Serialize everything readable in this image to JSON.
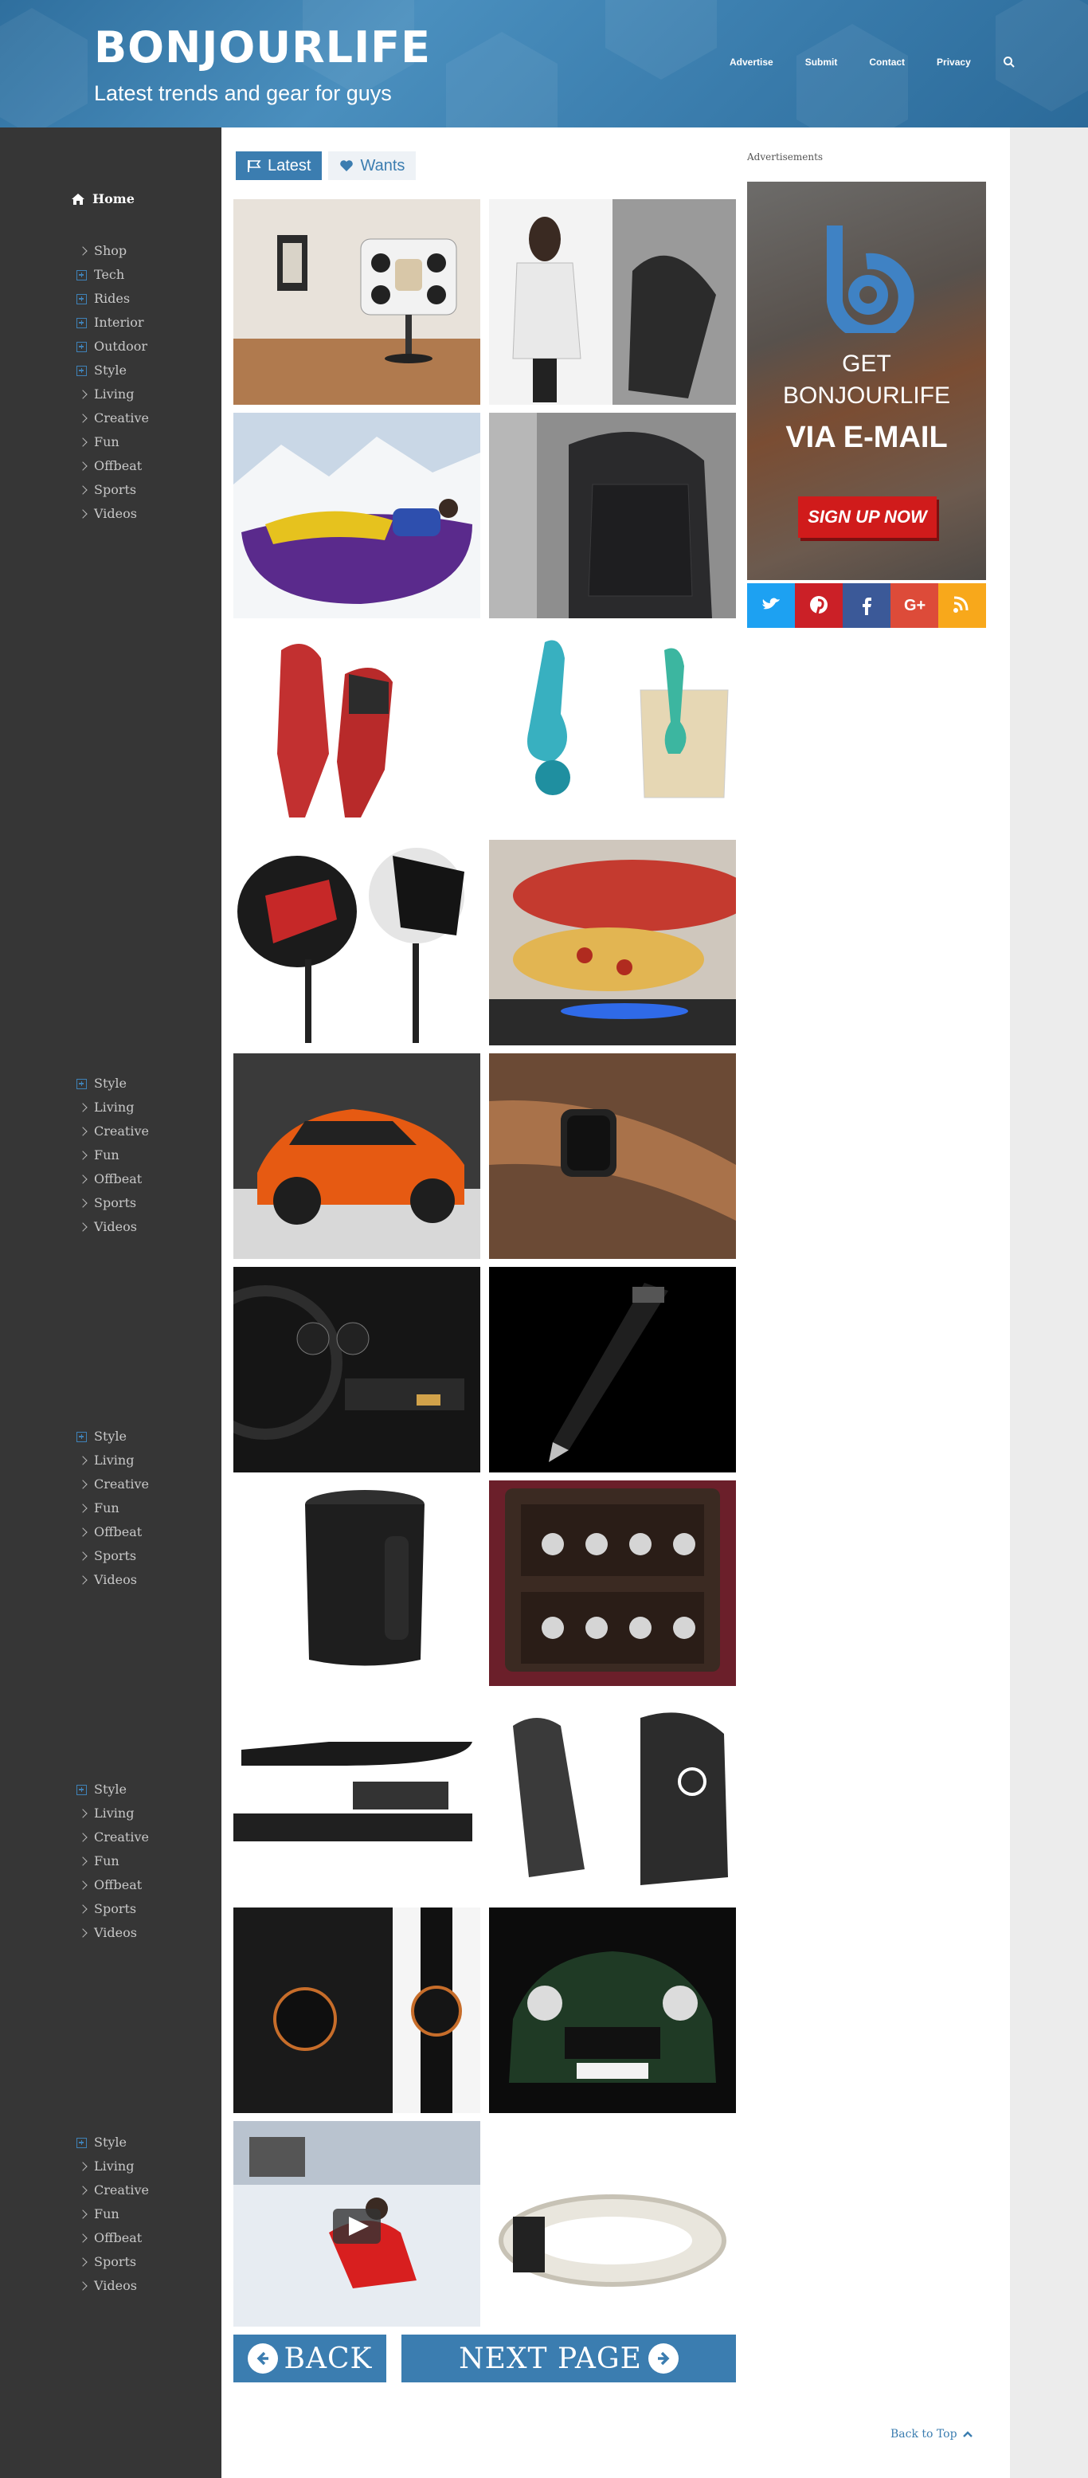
{
  "header": {
    "logo": "BONJOURLIFE",
    "tagline": "Latest trends and gear for guys",
    "nav": [
      "Advertise",
      "Submit",
      "Contact",
      "Privacy"
    ]
  },
  "sidebar": {
    "home": "Home",
    "main_menu": [
      {
        "label": "Shop",
        "icon": "chevron-right-icon"
      },
      {
        "label": "Tech",
        "icon": "plus-box-icon"
      },
      {
        "label": "Rides",
        "icon": "plus-box-icon"
      },
      {
        "label": "Interior",
        "icon": "plus-box-icon"
      },
      {
        "label": "Outdoor",
        "icon": "plus-box-icon"
      },
      {
        "label": "Style",
        "icon": "plus-box-icon"
      },
      {
        "label": "Living",
        "icon": "chevron-right-icon"
      },
      {
        "label": "Creative",
        "icon": "chevron-right-icon"
      },
      {
        "label": "Fun",
        "icon": "chevron-right-icon"
      },
      {
        "label": "Offbeat",
        "icon": "chevron-right-icon"
      },
      {
        "label": "Sports",
        "icon": "chevron-right-icon"
      },
      {
        "label": "Videos",
        "icon": "chevron-right-icon"
      }
    ],
    "repeat_menu": [
      {
        "label": "Style",
        "icon": "plus-box-icon"
      },
      {
        "label": "Living",
        "icon": "chevron-right-icon"
      },
      {
        "label": "Creative",
        "icon": "chevron-right-icon"
      },
      {
        "label": "Fun",
        "icon": "chevron-right-icon"
      },
      {
        "label": "Offbeat",
        "icon": "chevron-right-icon"
      },
      {
        "label": "Sports",
        "icon": "chevron-right-icon"
      },
      {
        "label": "Videos",
        "icon": "chevron-right-icon"
      }
    ]
  },
  "main": {
    "tabs": [
      {
        "label": "Latest",
        "icon": "flag-icon"
      },
      {
        "label": "Wants",
        "icon": "heart-icon"
      }
    ],
    "products": [
      "speaker-dock-image",
      "hooded-vest-image",
      "inflatable-lounger-image",
      "backpack-image",
      "red-gloves-image",
      "tea-infuser-image",
      "golf-driver-image",
      "pizza-oven-image",
      "orange-sports-car-image",
      "leather-watch-strap-image",
      "car-dashboard-image",
      "fountain-pen-image",
      "black-cooler-image",
      "watch-case-image",
      "knife-image",
      "hydration-pack-image",
      "chronograph-watch-image",
      "green-mini-image",
      "snowboard-video-image",
      "rope-bracelet-image"
    ],
    "back_label": "BACK",
    "next_label": "NEXT PAGE",
    "back_to_top": "Back to Top"
  },
  "ad": {
    "label": "Advertisements",
    "get": "GET",
    "brand": "BONJOURLIFE",
    "via": "VIA E-MAIL",
    "signup": "SIGN UP NOW"
  },
  "social": [
    {
      "name": "twitter-icon",
      "color": "#1da1f2"
    },
    {
      "name": "pinterest-icon",
      "color": "#cb2027"
    },
    {
      "name": "facebook-icon",
      "color": "#3b5998"
    },
    {
      "name": "google-plus-icon",
      "color": "#dd4b39"
    },
    {
      "name": "rss-icon",
      "color": "#f8a81b"
    }
  ],
  "colors": {
    "accent": "#3b7db0",
    "sidebar": "#363636",
    "header": "#3d80b0"
  }
}
